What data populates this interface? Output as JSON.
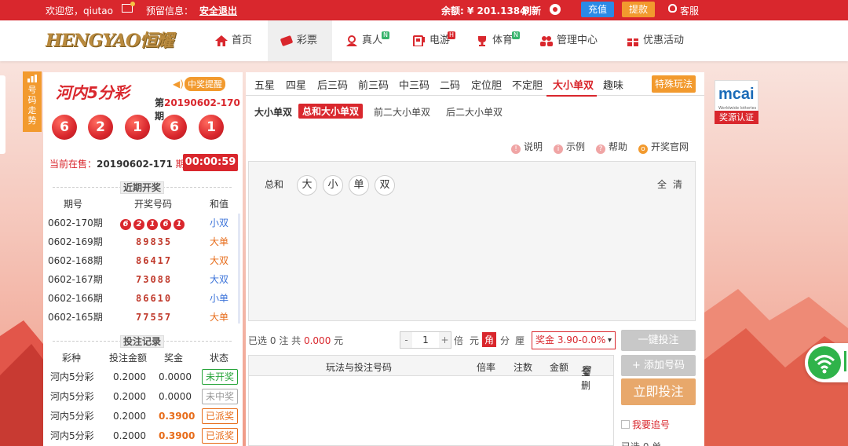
{
  "topbar": {
    "welcome": "欢迎您，qiutao",
    "reserve": "预留信息：",
    "logout": "安全退出",
    "balance": "余额: ¥ 201.1384",
    "refresh": "刷新",
    "recharge": "充值",
    "withdraw": "提款",
    "service": "客服"
  },
  "header": {
    "logo": "HENGYAO恒耀",
    "nav": [
      {
        "label": "首页",
        "icon": "home-icon",
        "badge": ""
      },
      {
        "label": "彩票",
        "icon": "lottery-ticket-icon",
        "badge": ""
      },
      {
        "label": "真人",
        "icon": "live-dealer-icon",
        "badge": "N"
      },
      {
        "label": "电游",
        "icon": "slot-machine-icon",
        "badge": "H"
      },
      {
        "label": "体育",
        "icon": "trophy-icon",
        "badge": "N"
      },
      {
        "label": "管理中心",
        "icon": "users-icon",
        "badge": ""
      },
      {
        "label": "优惠活动",
        "icon": "gift-icon",
        "badge": ""
      }
    ],
    "active_nav": "彩票"
  },
  "side_trend": {
    "label": "号码走势"
  },
  "lottery": {
    "logo": "河内5分彩",
    "logo_sub": "5fenmin",
    "prize_remind": "中奖提醒",
    "last_issue_prefix": "第",
    "last_issue": "20190602-170",
    "last_issue_suffix": "期",
    "balls": [
      "6",
      "2",
      "1",
      "6",
      "1"
    ],
    "current_label": "当前在售：",
    "current_issue": "20190602-171",
    "current_suffix": " 期",
    "countdown": "00:00:59"
  },
  "recent": {
    "title": "近期开奖",
    "headers": [
      "期号",
      "开奖号码",
      "和值"
    ],
    "rows": [
      {
        "issue": "0602-170期",
        "code": [
          "6",
          "2",
          "1",
          "6",
          "1"
        ],
        "sum": "小双",
        "sum_color": "blue"
      },
      {
        "issue": "0602-169期",
        "code": "89835",
        "sum": "大单",
        "sum_color": "orange"
      },
      {
        "issue": "0602-168期",
        "code": "86417",
        "sum": "大双",
        "sum_color": "orange"
      },
      {
        "issue": "0602-167期",
        "code": "73088",
        "sum": "大双",
        "sum_color": "blue"
      },
      {
        "issue": "0602-166期",
        "code": "86610",
        "sum": "小单",
        "sum_color": "blue"
      },
      {
        "issue": "0602-165期",
        "code": "77557",
        "sum": "大单",
        "sum_color": "orange"
      }
    ]
  },
  "records": {
    "title": "投注记录",
    "headers": [
      "彩种",
      "投注金额",
      "奖金",
      "状态"
    ],
    "rows": [
      {
        "game": "河内5分彩",
        "amount": "0.2000",
        "prize": "0.0000",
        "status": "未开奖",
        "status_color": "green"
      },
      {
        "game": "河内5分彩",
        "amount": "0.2000",
        "prize": "0.0000",
        "status": "未中奖",
        "status_color": "gray"
      },
      {
        "game": "河内5分彩",
        "amount": "0.2000",
        "prize": "0.3900",
        "status": "已派奖",
        "status_color": "orange"
      },
      {
        "game": "河内5分彩",
        "amount": "0.2000",
        "prize": "0.3900",
        "status": "已派奖",
        "status_color": "orange"
      }
    ]
  },
  "play_tabs": [
    "五星",
    "四星",
    "后三码",
    "前三码",
    "中三码",
    "二码",
    "定位胆",
    "不定胆",
    "大小单双",
    "趣味"
  ],
  "active_play_tab": "大小单双",
  "special_btn": "特殊玩法",
  "sub_tabs": {
    "label": "大小单双",
    "items": [
      "总和大小单双",
      "前二大小单双",
      "后二大小单双"
    ],
    "active": "总和大小单双"
  },
  "help_links": [
    "说明",
    "示例",
    "帮助",
    "开奖官网"
  ],
  "pick": {
    "label": "总和",
    "options": [
      "大",
      "小",
      "单",
      "双"
    ],
    "ctrl_all": "全",
    "ctrl_clear": "清"
  },
  "bet": {
    "selected_prefix": "已选",
    "selected_count": "0",
    "note_unit": "注 共",
    "amount": "0.000",
    "currency": "元",
    "multiplier": "1",
    "multiplier_label": "倍",
    "units": [
      "元",
      "角",
      "分",
      "厘"
    ],
    "active_unit": "角",
    "odds": "奖金 3.90-0.0%"
  },
  "bet_table": {
    "headers": [
      "玩法与投注号码",
      "倍率",
      "注数",
      "金额"
    ],
    "delete_all": "全删"
  },
  "actions": {
    "quick_bet": "一键投注",
    "add_number": "+ 添加号码",
    "submit": "立即投注",
    "chase": "我要追号",
    "selected_note": "已选 0 单"
  },
  "cert": {
    "brand": "mcai",
    "sub": "Worldwide lotteries",
    "label": "奖源认证"
  },
  "colors": {
    "primary_red": "#d9272d",
    "orange": "#f29a2e",
    "blue": "#2b8ae6"
  }
}
